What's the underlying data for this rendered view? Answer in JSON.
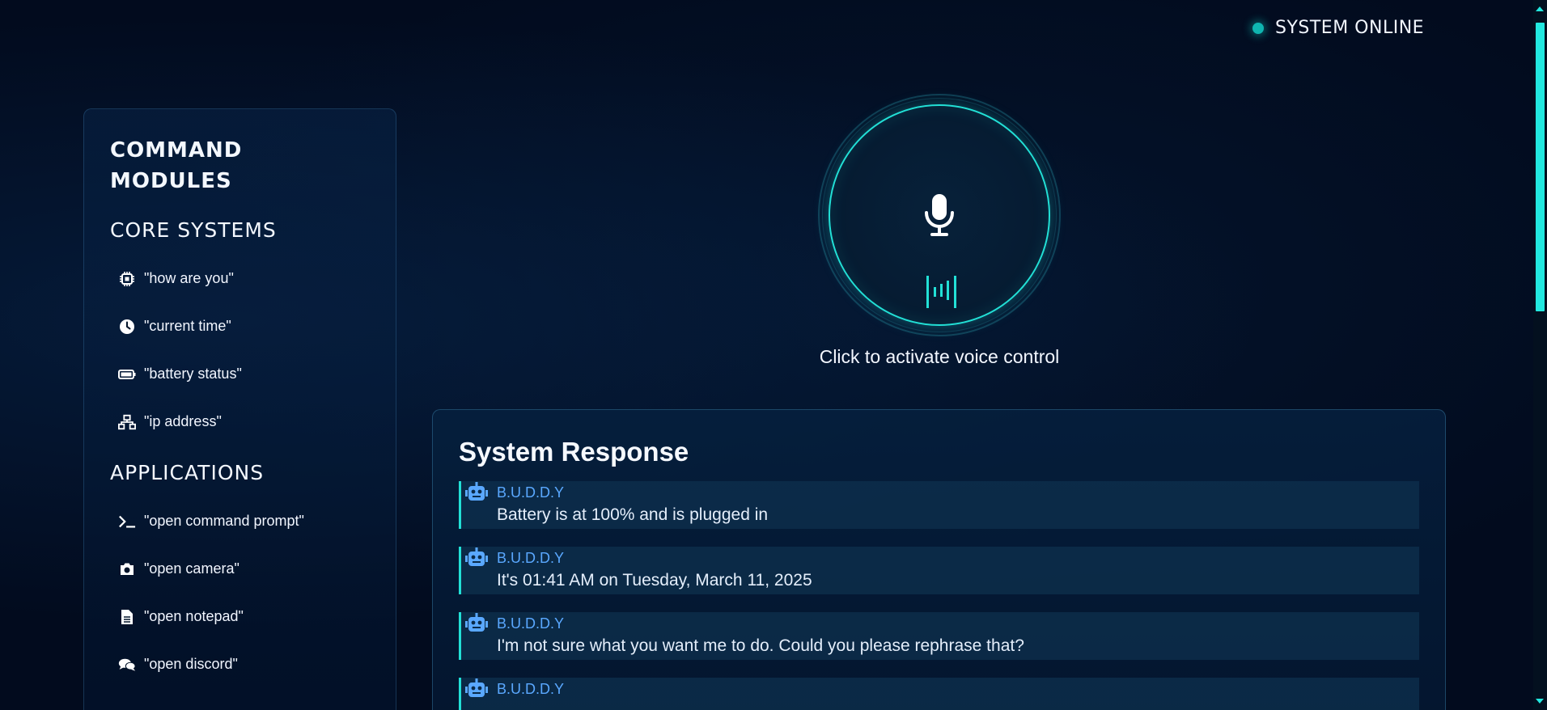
{
  "status": {
    "label": "SYSTEM ONLINE",
    "color": "#0fb5b0"
  },
  "sidebar": {
    "title": "COMMAND MODULES",
    "sections": [
      {
        "heading": "CORE SYSTEMS",
        "items": [
          {
            "icon": "cpu-icon",
            "label": "\"how are you\""
          },
          {
            "icon": "clock-icon",
            "label": "\"current time\""
          },
          {
            "icon": "battery-icon",
            "label": "\"battery status\""
          },
          {
            "icon": "network-icon",
            "label": "\"ip address\""
          }
        ]
      },
      {
        "heading": "APPLICATIONS",
        "items": [
          {
            "icon": "terminal-icon",
            "label": "\"open command prompt\""
          },
          {
            "icon": "camera-icon",
            "label": "\"open camera\""
          },
          {
            "icon": "file-icon",
            "label": "\"open notepad\""
          },
          {
            "icon": "chat-icon",
            "label": "\"open discord\""
          }
        ]
      }
    ]
  },
  "voice": {
    "caption": "Click to activate voice control",
    "accent": "#22e0d6"
  },
  "response": {
    "title": "System Response",
    "messages": [
      {
        "sender": "B.U.D.D.Y",
        "text": "Battery is at 100% and is plugged in"
      },
      {
        "sender": "B.U.D.D.Y",
        "text": "It's 01:41 AM on Tuesday, March 11, 2025"
      },
      {
        "sender": "B.U.D.D.Y",
        "text": "I'm not sure what you want me to do. Could you please rephrase that?"
      },
      {
        "sender": "B.U.D.D.Y",
        "text": ""
      }
    ]
  }
}
